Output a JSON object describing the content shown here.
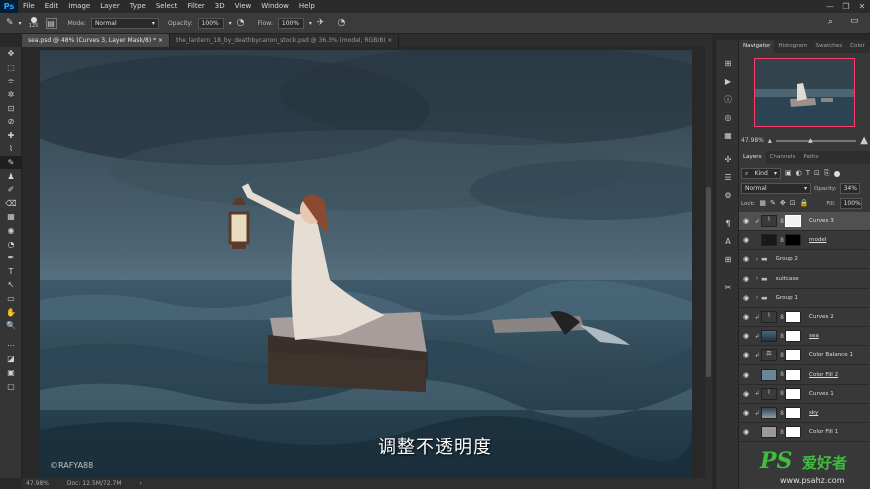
{
  "app": {
    "logo": "Ps"
  },
  "menu": [
    "File",
    "Edit",
    "Image",
    "Layer",
    "Type",
    "Select",
    "Filter",
    "3D",
    "View",
    "Window",
    "Help"
  ],
  "window_controls": [
    "—",
    "❐",
    "✕"
  ],
  "options": {
    "brush_size": "125",
    "mode_label": "Mode:",
    "mode_value": "Normal",
    "opacity_label": "Opacity:",
    "opacity_value": "100%",
    "flow_label": "Flow:",
    "flow_value": "100%"
  },
  "doc_tabs": [
    {
      "label": "sea.psd @ 48% (Curves 3, Layer Mask/8) *",
      "close": "×"
    },
    {
      "label": "the_lantern_18_by_deathbycanon_stock.psd @ 36.3% (model, RGB/8)",
      "close": "×"
    }
  ],
  "tools": [
    "✥",
    "⬚",
    "⌯",
    "✲",
    "⊡",
    "⊘",
    "✚",
    "⌇",
    "✎",
    "♟",
    "✐",
    "⌫",
    "▦",
    "◉",
    "◔",
    "✒",
    "T",
    "↖",
    "▭",
    "✋",
    "🔍",
    "⋯",
    "◪",
    "▣",
    "▢"
  ],
  "status": {
    "zoom": "47.98%",
    "doc": "Doc: 12.5M/72.7M",
    "arrow": "›"
  },
  "navigator": {
    "tabs": [
      "Navigator",
      "Histogram",
      "Swatches",
      "Color"
    ],
    "zoom": "47.98%"
  },
  "layers_panel": {
    "tabs": [
      "Layers",
      "Channels",
      "Paths"
    ],
    "kind_label": "Kind",
    "blend_mode": "Normal",
    "opacity_label": "Opacity:",
    "opacity_value": "34%",
    "lock_label": "Lock:",
    "fill_label": "Fill:",
    "fill_value": "100%",
    "layers": [
      {
        "name": "Curves 3",
        "type": "adjust",
        "selected": true
      },
      {
        "name": "model",
        "type": "model",
        "selected": false
      },
      {
        "name": "Group 2",
        "type": "group",
        "selected": false
      },
      {
        "name": "suitcase",
        "type": "group",
        "selected": false
      },
      {
        "name": "Group 1",
        "type": "group",
        "selected": false
      },
      {
        "name": "Curves 2",
        "type": "adjust",
        "selected": false
      },
      {
        "name": "sea",
        "type": "sea",
        "selected": false
      },
      {
        "name": "Color Balance 1",
        "type": "balance",
        "selected": false
      },
      {
        "name": "Color Fill 2",
        "type": "fill2",
        "selected": false
      },
      {
        "name": "Curves 1",
        "type": "adjust",
        "selected": false
      },
      {
        "name": "sky",
        "type": "sky",
        "selected": false
      },
      {
        "name": "Color Fill 1",
        "type": "fill1",
        "selected": false
      }
    ]
  },
  "subtitle": "调整不透明度",
  "watermark": "©RAFYA88",
  "site_logo": {
    "ps": "PS",
    "cn": "爱好者",
    "url": "www.psahz.com"
  },
  "colors": {
    "accent": "#31a8ff",
    "nav_frame": "#ff3b6b",
    "site_logo": "#3fbd3f"
  }
}
